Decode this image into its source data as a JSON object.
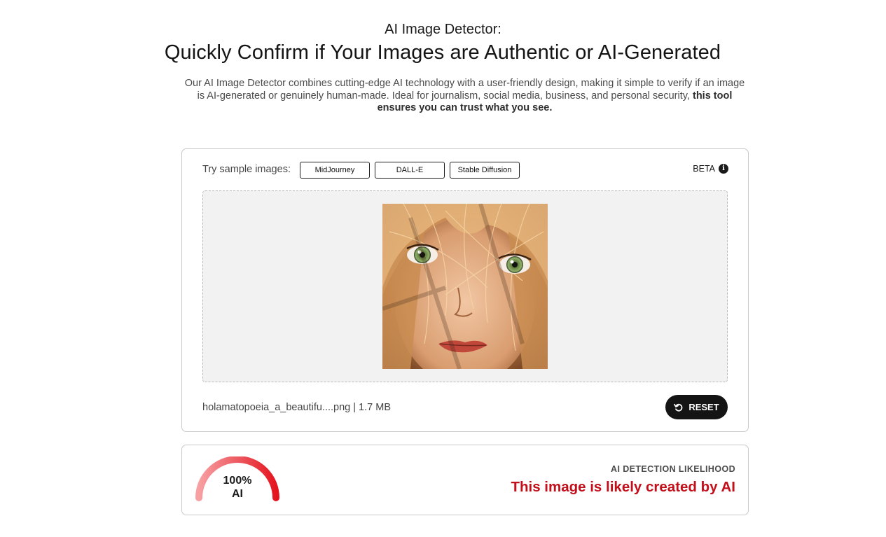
{
  "header": {
    "kicker": "AI Image Detector:",
    "headline": "Quickly Confirm if Your Images are Authentic or AI-Generated",
    "intro_text": "Our AI Image Detector combines cutting-edge AI technology with a user-friendly design, making it simple to verify if an image is AI-generated or genuinely human-made. Ideal for journalism, social media, business, and personal security, ",
    "intro_bold": "this tool ensures you can trust what you see."
  },
  "upload": {
    "samples_label": "Try sample images:",
    "sample_buttons": [
      "MidJourney",
      "DALL-E",
      "Stable Diffusion"
    ],
    "beta_label": "BETA",
    "info_glyph": "i",
    "file_info": "holamatopoeia_a_beautifu....png | 1.7 MB",
    "reset_label": "RESET"
  },
  "result": {
    "gauge_value": "100%",
    "gauge_unit": "AI",
    "gauge_fraction": 1.0,
    "likelihood_label": "AI DETECTION LIKELIHOOD",
    "verdict": "This image is likely created by AI"
  },
  "colors": {
    "accent_dark": "#141414",
    "verdict_red": "#c20f1a",
    "gauge_start": "#f7a0a3",
    "gauge_end": "#e4141f"
  }
}
